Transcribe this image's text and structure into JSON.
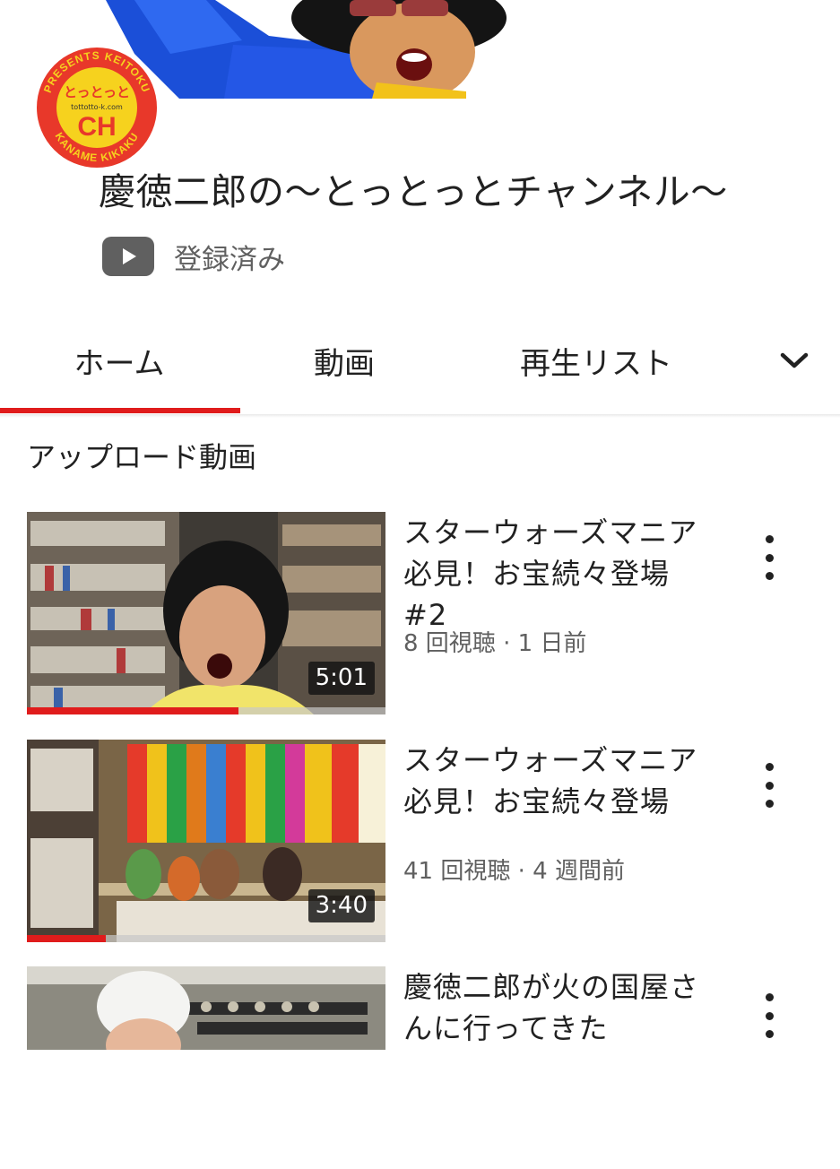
{
  "channel": {
    "logo_text_top": "PRESENTS KEITOKU",
    "logo_text_bottom": "KANAME KIKAKU",
    "logo_name": "とっとっと",
    "logo_url": "tottotto-k.com",
    "logo_ch": "CH",
    "title": "慶徳二郎の〜とっとっとチャンネル〜",
    "subscribe_icon": "youtube-play-icon",
    "subscribed_label": "登録済み"
  },
  "tabs": [
    {
      "label": "ホーム",
      "selected": true
    },
    {
      "label": "動画",
      "selected": false
    },
    {
      "label": "再生リスト",
      "selected": false
    }
  ],
  "tabs_more_icon": "chevron-down-icon",
  "section": {
    "title": "アップロード動画"
  },
  "videos": [
    {
      "title": "スターウォーズマニア必見！お宝続々登場#2",
      "meta": "8 回視聴 · 1 日前",
      "duration": "5:01",
      "progress": 0.59
    },
    {
      "title": "スターウォーズマニア必見！お宝続々登場",
      "meta": "41 回視聴 · 4 週間前",
      "duration": "3:40",
      "progress": 0.22
    },
    {
      "title": "慶徳二郎が火の国屋さんに行ってきた",
      "meta": "",
      "duration": "",
      "progress": 0
    }
  ],
  "colors": {
    "accent": "#e01c1c",
    "text_primary": "#212121",
    "text_secondary": "#606060",
    "logo_red": "#e8382a",
    "logo_yellow": "#f6d21e"
  }
}
